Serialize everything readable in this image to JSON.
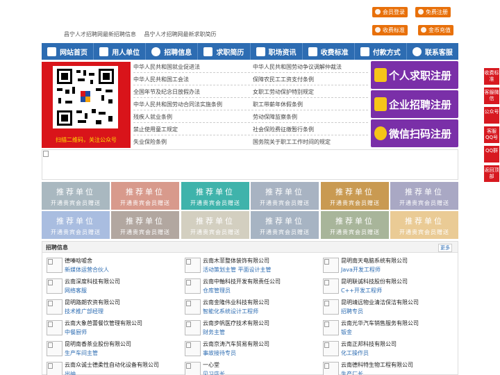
{
  "top": {
    "links": [
      "昌宁人才招聘网最新招聘信息",
      "昌宁人才招聘网最新求职简历"
    ],
    "buttons": [
      "会员登录",
      "免费注册",
      "收费标准",
      "金币充值"
    ]
  },
  "nav": [
    "网站首页",
    "用人单位",
    "招聘信息",
    "求职简历",
    "职场资讯",
    "收费标准",
    "付款方式",
    "联系客服"
  ],
  "qr": {
    "caption": "扫描二维码，关注公众号"
  },
  "laws": {
    "left": [
      "中华人民共和国就业促进法",
      "中华人民共和国工会法",
      "全国年节及纪念日放假办法",
      "中华人民共和国劳动合同法实施条例",
      "残疾人就业条例",
      "禁止使用童工规定",
      "失业保险条例"
    ],
    "right": [
      "中华人民共和国劳动争议调解仲裁法",
      "保障农民工工资支付条例",
      "女职工劳动保护特别规定",
      "职工带薪年休假条例",
      "劳动保障监察条例",
      "社会保险费征缴暂行条例",
      "国务院关于职工工作时间的规定"
    ]
  },
  "register": [
    "个人求职注册",
    "企业招聘注册",
    "微信扫码注册"
  ],
  "tiles": {
    "title": "推荐单位",
    "subtitle": "开通贵宾会员赠送",
    "colors": [
      "#a9b8c0",
      "#d89a8c",
      "#3fb3ab",
      "#a8b3c2",
      "#c99a52",
      "#a9a8c4",
      "#a9bde0",
      "#b2a7a0",
      "#d3cfc0",
      "#a7b4c3",
      "#a8b59a",
      "#eacb95"
    ]
  },
  "jobs": {
    "title": "招聘信息",
    "more": "更多",
    "columns": [
      [
        {
          "company": "德嗪晗嘘舍",
          "job": "新媒体运营合伙人"
        },
        {
          "company": "云南深度科技有限公司",
          "job": "网络客服"
        },
        {
          "company": "昆明路朗农资有限公司",
          "job": "技术推广部经理"
        },
        {
          "company": "云南大象芭蕾餐饮管理有限公司",
          "job": "中餐厨师"
        },
        {
          "company": "昆明南香茶业股份有限公司",
          "job": "生产车间主管"
        },
        {
          "company": "云南众诚士德柔性自动化设备有限公司",
          "job": "出纳"
        }
      ],
      [
        {
          "company": "云南木菲整体装饰有限公司",
          "job": "活动策划主管 平面设计主管"
        },
        {
          "company": "云南中軸科技开发有限责任公司",
          "job": "仓库管理员"
        },
        {
          "company": "云南金隆伟业科技有限公司",
          "job": "智能化系统设计工程师"
        },
        {
          "company": "云南步帆医疗技术有限公司",
          "job": "财务主管"
        },
        {
          "company": "云南京涛汽车贸易有限公司",
          "job": "事故接待专员"
        },
        {
          "company": "一心堂",
          "job": "见习店长"
        }
      ],
      [
        {
          "company": "昆明南天电脑系统有限公司",
          "job": "Java开发工程师"
        },
        {
          "company": "昆明联诚科技股份有限公司",
          "job": "C++开发工程师"
        },
        {
          "company": "昆明靖远物业清洁保洁有限公司",
          "job": "招聘专员"
        },
        {
          "company": "云南光华汽车销售服务有限公司",
          "job": "钣金"
        },
        {
          "company": "云南正邦科技有限公司",
          "job": "化工操作员"
        },
        {
          "company": "云南德科特生物工程有限公司",
          "job": "生产厂长"
        }
      ]
    ]
  },
  "side": [
    "收费标准",
    "客服微信",
    "公众号",
    "客服QQ号",
    "QQ群",
    "返回顶部"
  ]
}
